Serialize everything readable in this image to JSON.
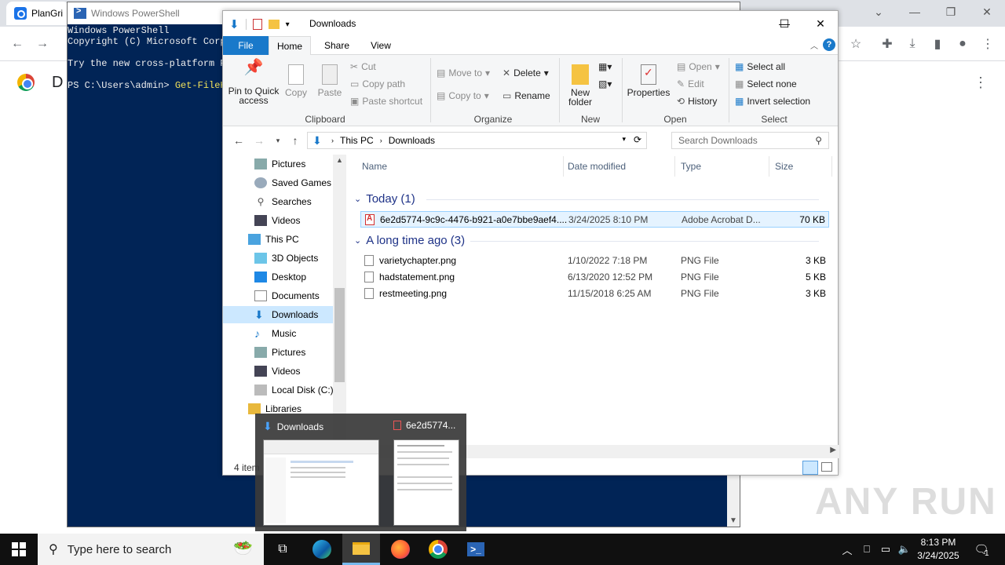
{
  "chrome": {
    "tab_title": "PlanGri",
    "page_partial_letter": "D"
  },
  "powershell": {
    "title": "Windows PowerShell",
    "lines": [
      "Windows PowerShell",
      "Copyright (C) Microsoft Corp",
      "",
      "Try the new cross-platform P",
      ""
    ],
    "prompt": "PS C:\\Users\\admin> ",
    "command": "Get-FileH"
  },
  "explorer": {
    "title": "Downloads",
    "ribbon_tabs": [
      "File",
      "Home",
      "Share",
      "View"
    ],
    "clipboard": {
      "pin_label": "Pin to Quick access",
      "copy": "Copy",
      "paste": "Paste",
      "cut": "Cut",
      "copy_path": "Copy path",
      "paste_shortcut": "Paste shortcut",
      "group": "Clipboard"
    },
    "organize": {
      "move_to": "Move to",
      "copy_to": "Copy to",
      "delete": "Delete",
      "rename": "Rename",
      "group": "Organize"
    },
    "new_group": {
      "new_folder": "New folder",
      "group": "New"
    },
    "open_group": {
      "properties": "Properties",
      "open": "Open",
      "edit": "Edit",
      "history": "History",
      "group": "Open"
    },
    "select_group": {
      "select_all": "Select all",
      "select_none": "Select none",
      "invert": "Invert selection",
      "group": "Select"
    },
    "breadcrumb": [
      "This PC",
      "Downloads"
    ],
    "search_placeholder": "Search Downloads",
    "nav_items": [
      {
        "label": "Pictures",
        "icon": "pictures-icon"
      },
      {
        "label": "Saved Games",
        "icon": "saved-games-icon"
      },
      {
        "label": "Searches",
        "icon": "search-icon"
      },
      {
        "label": "Videos",
        "icon": "videos-icon"
      },
      {
        "label": "This PC",
        "icon": "computer-icon"
      },
      {
        "label": "3D Objects",
        "icon": "3d-objects-icon"
      },
      {
        "label": "Desktop",
        "icon": "desktop-icon"
      },
      {
        "label": "Documents",
        "icon": "documents-icon"
      },
      {
        "label": "Downloads",
        "icon": "download-icon"
      },
      {
        "label": "Music",
        "icon": "music-icon"
      },
      {
        "label": "Pictures",
        "icon": "pictures-icon"
      },
      {
        "label": "Videos",
        "icon": "videos-icon"
      },
      {
        "label": "Local Disk (C:)",
        "icon": "disk-icon"
      },
      {
        "label": "Libraries",
        "icon": "libraries-icon"
      }
    ],
    "columns": [
      "Name",
      "Date modified",
      "Type",
      "Size"
    ],
    "groups": [
      {
        "label": "Today (1)",
        "files": [
          {
            "name": "6e2d5774-9c9c-4476-b921-a0e7bbe9aef4....",
            "date": "3/24/2025 8:10 PM",
            "type": "Adobe Acrobat D...",
            "size": "70 KB",
            "icon": "pdf"
          }
        ]
      },
      {
        "label": "A long time ago (3)",
        "files": [
          {
            "name": "varietychapter.png",
            "date": "1/10/2022 7:18 PM",
            "type": "PNG File",
            "size": "3 KB",
            "icon": "png"
          },
          {
            "name": "hadstatement.png",
            "date": "6/13/2020 12:52 PM",
            "type": "PNG File",
            "size": "5 KB",
            "icon": "png"
          },
          {
            "name": "restmeeting.png",
            "date": "11/15/2018 6:25 AM",
            "type": "PNG File",
            "size": "3 KB",
            "icon": "png"
          }
        ]
      }
    ],
    "status": "4 item"
  },
  "thumbnails": [
    {
      "title": "Downloads"
    },
    {
      "title": "6e2d5774..."
    }
  ],
  "watermark": "ANY RUN",
  "taskbar": {
    "search_placeholder": "Type here to search",
    "time": "8:13 PM",
    "date": "3/24/2025",
    "notification_count": "1"
  },
  "colors": {
    "ps_background": "#012456",
    "ribbon_file_tab": "#1979ca",
    "selection": "#cce8ff",
    "taskbar": "#101010"
  }
}
